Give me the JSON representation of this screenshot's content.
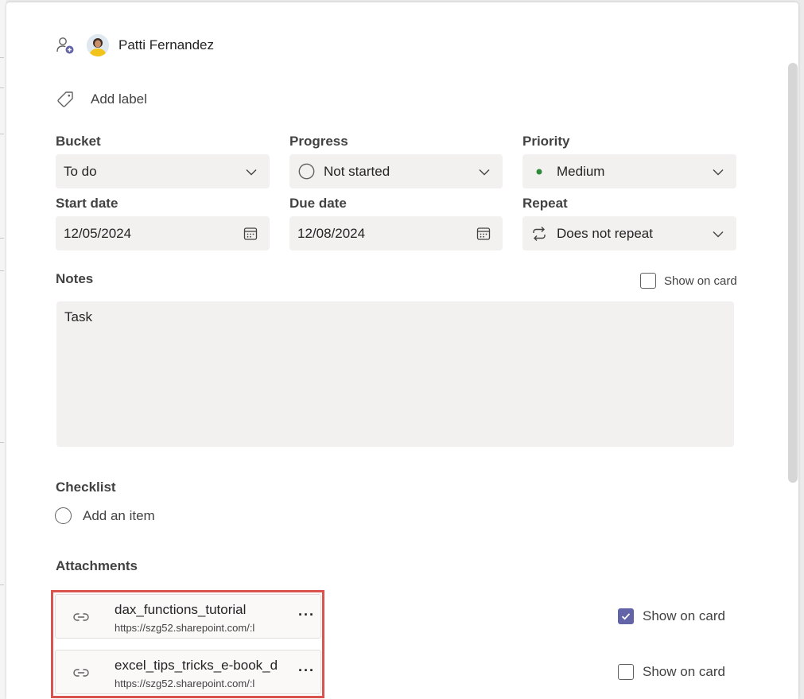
{
  "assignee": {
    "name": "Patti Fernandez"
  },
  "label": {
    "add_text": "Add label"
  },
  "fields": {
    "bucket": {
      "label": "Bucket",
      "value": "To do"
    },
    "progress": {
      "label": "Progress",
      "value": "Not started"
    },
    "priority": {
      "label": "Priority",
      "value": "Medium",
      "dot_color": "#2f8a3b"
    },
    "start_date": {
      "label": "Start date",
      "value": "12/05/2024"
    },
    "due_date": {
      "label": "Due date",
      "value": "12/08/2024"
    },
    "repeat": {
      "label": "Repeat",
      "value": "Does not repeat"
    }
  },
  "notes": {
    "label": "Notes",
    "show_on_card": "Show on card",
    "show_on_card_checked": false,
    "text": "Task"
  },
  "checklist": {
    "label": "Checklist",
    "add_item": "Add an item"
  },
  "attachments": {
    "label": "Attachments",
    "items": [
      {
        "name": "dax_functions_tutorial",
        "url": "https://szg52.sharepoint.com/:l",
        "show_on_card": "Show on card",
        "show_on_card_checked": true
      },
      {
        "name": "excel_tips_tricks_e-book_d",
        "url": "https://szg52.sharepoint.com/:l",
        "show_on_card": "Show on card",
        "show_on_card_checked": false
      }
    ]
  },
  "colors": {
    "accent": "#6264a7",
    "highlight": "#d9534f",
    "field_bg": "#f3f1ef"
  }
}
